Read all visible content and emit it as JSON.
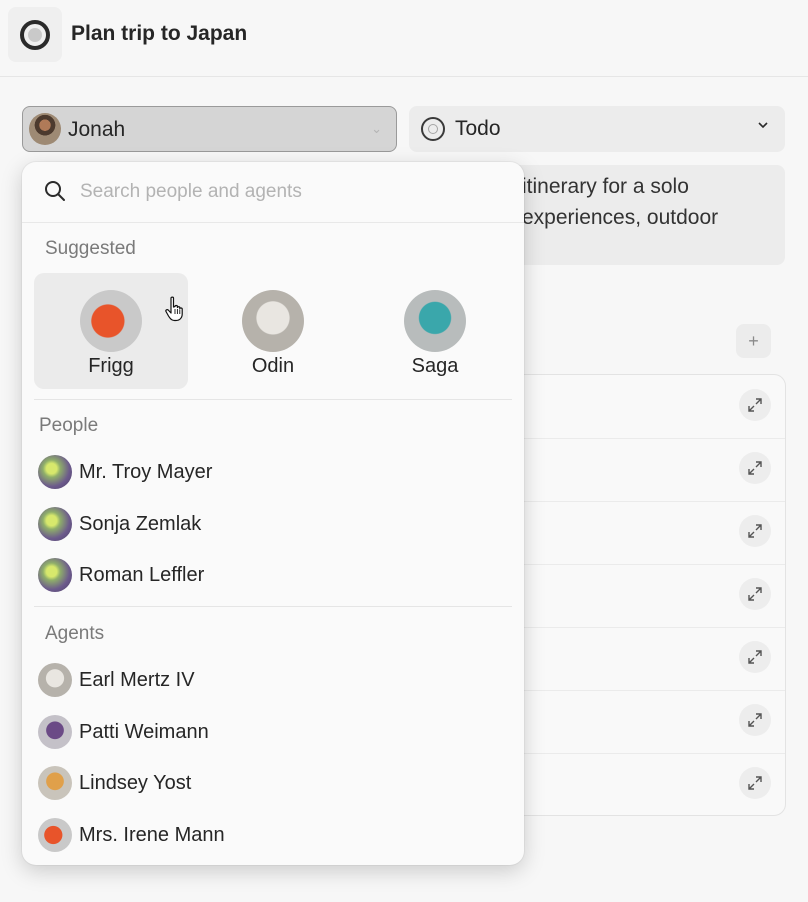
{
  "header": {
    "title": "Plan trip to Japan",
    "icon": "circle-status-icon"
  },
  "assignee": {
    "name": "Jonah",
    "icon": "chevron-down-icon"
  },
  "status": {
    "label": "Todo",
    "icon": "todo-circle-icon"
  },
  "description": {
    "text": "itinerary for a solo experiences, outdoor"
  },
  "dropdown": {
    "search_placeholder": "Search people and agents",
    "suggested_label": "Suggested",
    "suggested": [
      {
        "name": "Frigg",
        "avatar": "red-sculpture"
      },
      {
        "name": "Odin",
        "avatar": "stone-sculpture"
      },
      {
        "name": "Saga",
        "avatar": "teal-sculpture"
      }
    ],
    "people_label": "People",
    "people": [
      {
        "name": "Mr. Troy Mayer"
      },
      {
        "name": "Sonja Zemlak"
      },
      {
        "name": "Roman Leffler"
      }
    ],
    "agents_label": "Agents",
    "agents": [
      {
        "name": "Earl Mertz IV",
        "avatar": "stone-sculpture"
      },
      {
        "name": "Patti Weimann",
        "avatar": "purple-sculpture"
      },
      {
        "name": "Lindsey Yost",
        "avatar": "orange-sculpture"
      },
      {
        "name": "Mrs. Irene Mann",
        "avatar": "red-sculpture"
      }
    ]
  },
  "colors": {
    "background": "#f7f7f7",
    "dropdown": "#fafafa",
    "hover": "#ebebeb",
    "muted_text": "#7a7a7a"
  }
}
